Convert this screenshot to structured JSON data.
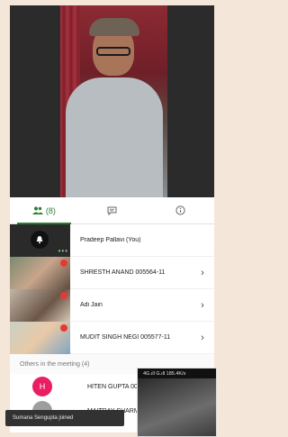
{
  "tabs": {
    "participants_count": "(8)"
  },
  "participants": [
    {
      "name": "Pradeep Pallavi (You)",
      "chevron": ""
    },
    {
      "name": "SHRESTH ANAND 005564-11",
      "chevron": "›"
    },
    {
      "name": "Adi Jain",
      "chevron": "›"
    },
    {
      "name": "MUDIT SINGH NEGI 005577-11",
      "chevron": "›"
    }
  ],
  "others": {
    "header": "Others in the meeting (4)",
    "items": [
      {
        "initial": "H",
        "name": "HITEN GUPTA 00",
        "color": "#e91e63"
      },
      {
        "initial": "",
        "name": "MAITRAY SHARM",
        "color": "#9e9e9e"
      }
    ]
  },
  "toast": "Sumana Sengupta joined",
  "pip": {
    "status": "4G.ıll G.ıll 185.4K/s"
  },
  "colors": {
    "accent": "#2e7d32",
    "mute": "#e53935"
  }
}
